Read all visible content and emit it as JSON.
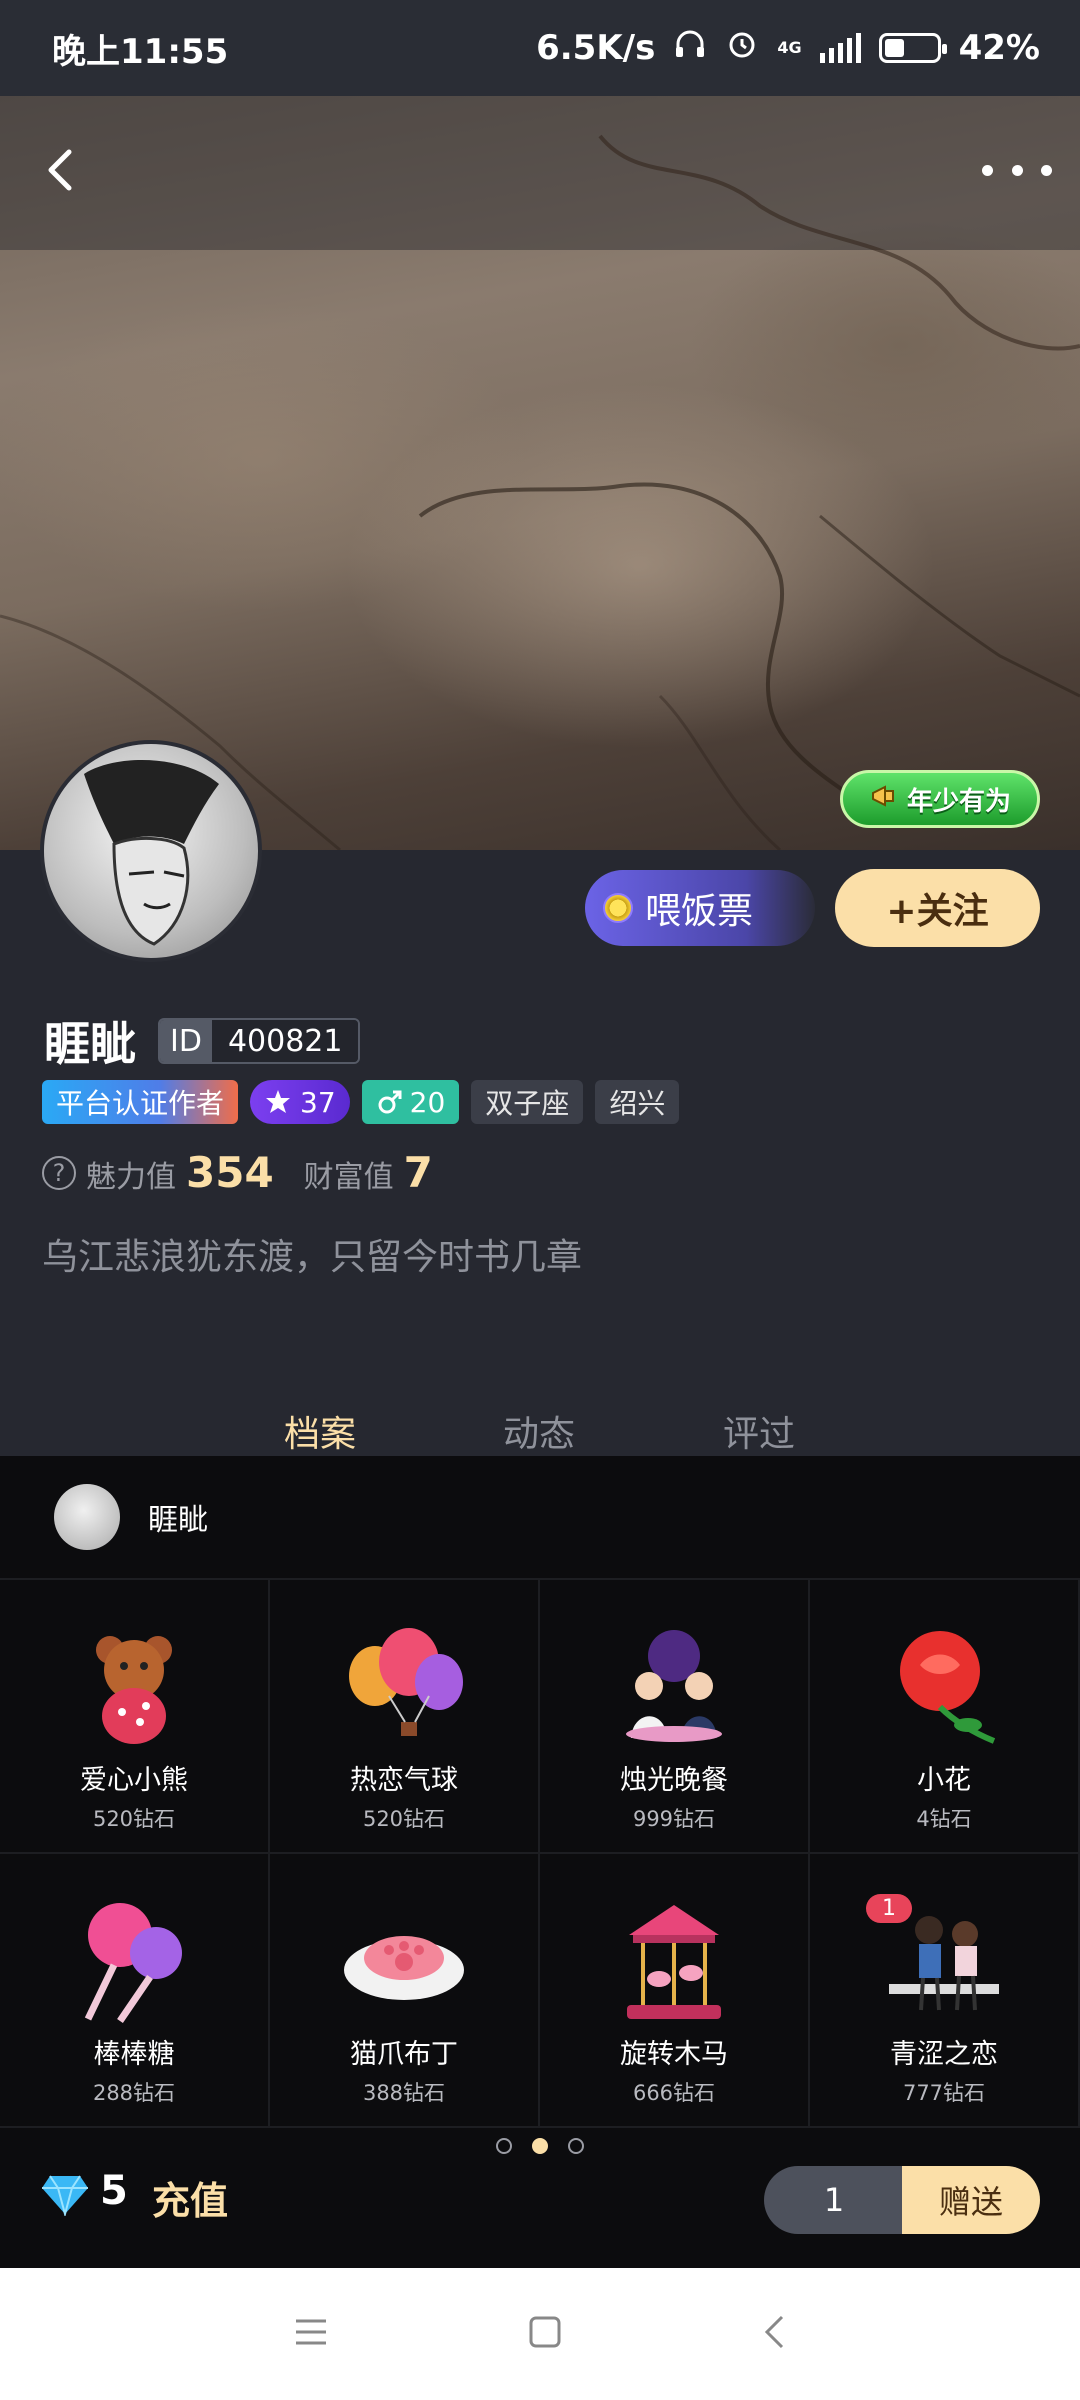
{
  "status_bar": {
    "time": "晚上11:55",
    "net_speed": "6.5K/s",
    "network_type": "4G",
    "battery": "42%",
    "battery_level": 0.42
  },
  "banner": {
    "youth_badge": "年少有为"
  },
  "actions": {
    "feed_ticket": "喂饭票",
    "follow": "+关注"
  },
  "profile": {
    "name": "睚眦",
    "id_label": "ID",
    "id_value": "400821",
    "tags": {
      "certified": "平台认证作者",
      "level": "37",
      "age": "20",
      "zodiac": "双子座",
      "city": "绍兴"
    },
    "charm_label": "魅力值",
    "charm_value": "354",
    "wealth_label": "财富值",
    "wealth_value": "7",
    "bio": "乌江悲浪犹东渡，只留今时书几章"
  },
  "tabs": [
    {
      "label": "档案",
      "active": true
    },
    {
      "label": "动态",
      "active": false
    },
    {
      "label": "评过",
      "active": false
    }
  ],
  "gift_panel": {
    "recipient": "睚眦",
    "gifts": [
      {
        "name": "爱心小熊",
        "price": "520钻石",
        "icon": "teddy-bear-icon"
      },
      {
        "name": "热恋气球",
        "price": "520钻石",
        "icon": "hot-air-balloon-icon"
      },
      {
        "name": "烛光晚餐",
        "price": "999钻石",
        "icon": "candle-dinner-icon"
      },
      {
        "name": "小花",
        "price": "4钻石",
        "icon": "rose-icon"
      },
      {
        "name": "棒棒糖",
        "price": "288钻石",
        "icon": "lollipop-icon"
      },
      {
        "name": "猫爪布丁",
        "price": "388钻石",
        "icon": "cat-paw-pudding-icon"
      },
      {
        "name": "旋转木马",
        "price": "666钻石",
        "icon": "carousel-icon"
      },
      {
        "name": "青涩之恋",
        "price": "777钻石",
        "icon": "young-couple-icon",
        "count": "1"
      }
    ],
    "page_count": 3,
    "active_page": 2,
    "diamonds": "5",
    "recharge": "充值",
    "quantity": "1",
    "send": "赠送"
  },
  "colors": {
    "accent": "#fbdfa8",
    "background": "#262830",
    "panel": "#0c0c0e"
  }
}
